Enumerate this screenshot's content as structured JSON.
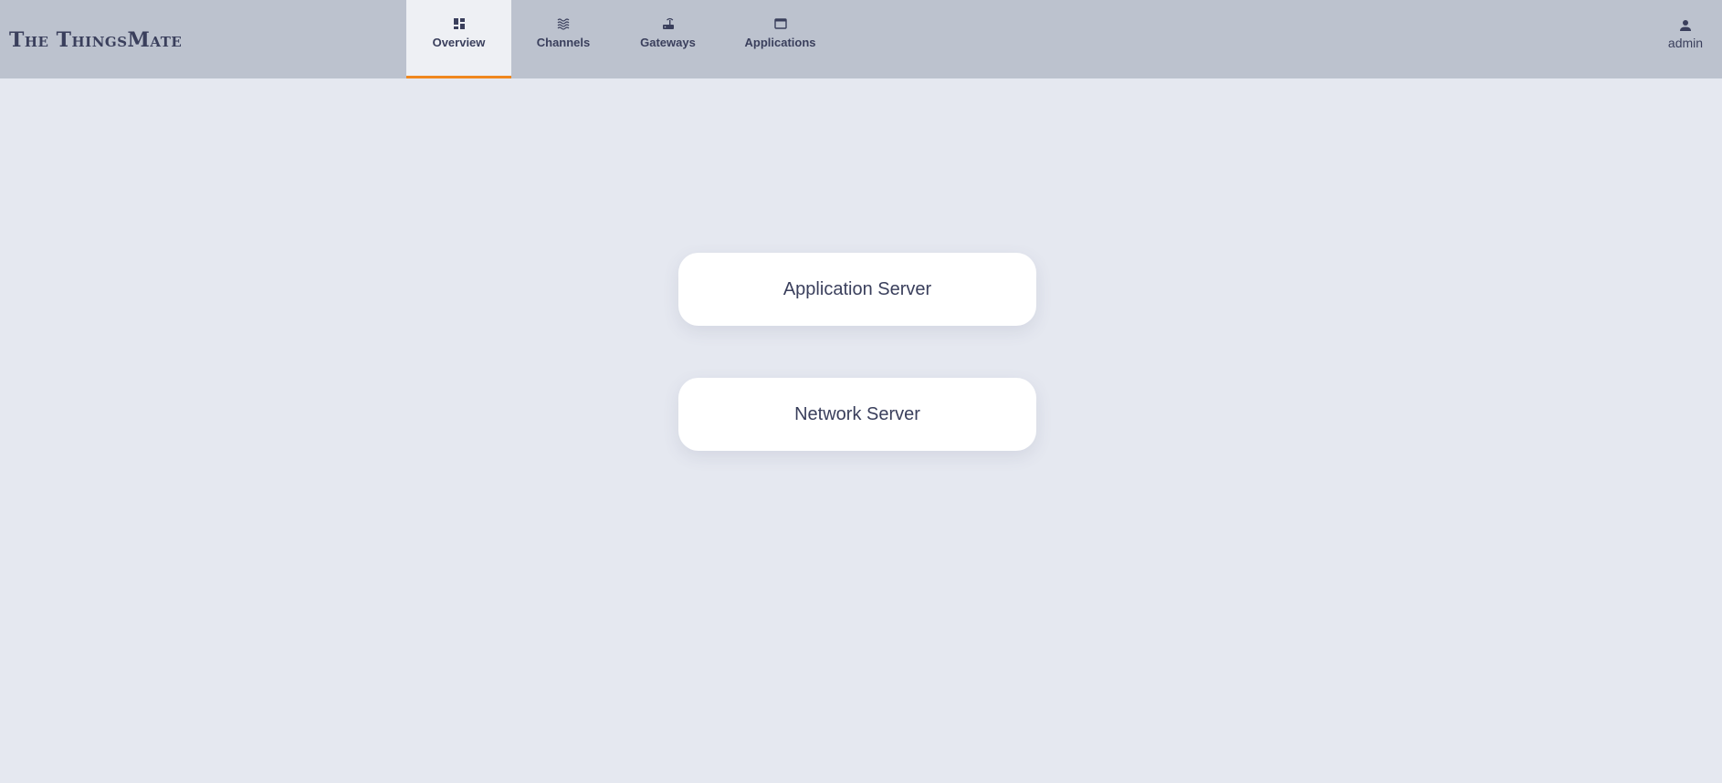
{
  "brand": {
    "name": "The ThingsMate"
  },
  "nav": {
    "tabs": [
      {
        "label": "Overview",
        "icon": "dashboard-icon",
        "active": true
      },
      {
        "label": "Channels",
        "icon": "waves-icon",
        "active": false
      },
      {
        "label": "Gateways",
        "icon": "router-icon",
        "active": false
      },
      {
        "label": "Applications",
        "icon": "window-icon",
        "active": false
      }
    ]
  },
  "user": {
    "name": "admin",
    "icon": "person-icon"
  },
  "main": {
    "cards": [
      {
        "label": "Application Server"
      },
      {
        "label": "Network Server"
      }
    ]
  },
  "colors": {
    "header_bg": "#bcc2ce",
    "page_bg": "#e5e8f0",
    "active_tab_bg": "#eef0f4",
    "accent": "#f0871e",
    "text": "#3a3f5c"
  }
}
